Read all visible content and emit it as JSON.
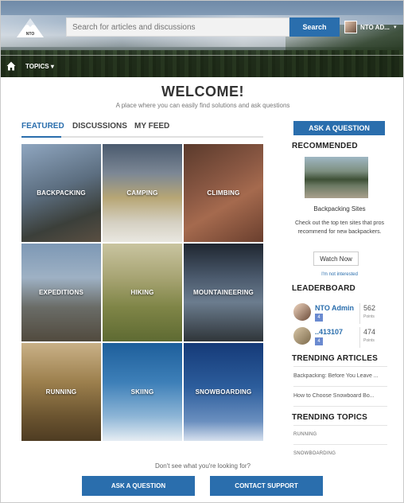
{
  "header": {
    "logo_text": "NTO",
    "search_placeholder": "Search for articles and discussions",
    "search_button": "Search",
    "user_name": "NTO AD...",
    "nav_topics": "TOPICS"
  },
  "main": {
    "welcome": "WELCOME!",
    "subtitle": "A place where you can easily find solutions and ask questions",
    "tabs": [
      "FEATURED",
      "DISCUSSIONS",
      "MY FEED"
    ],
    "active_tab": "FEATURED",
    "tiles": [
      {
        "label": "BACKPACKING",
        "color": "#5f6e7e"
      },
      {
        "label": "CAMPING",
        "color": "#8a8c80"
      },
      {
        "label": "CLIMBING",
        "color": "#7d4a36"
      },
      {
        "label": "EXPEDITIONS",
        "color": "#6a7d90"
      },
      {
        "label": "HIKING",
        "color": "#8d8a52"
      },
      {
        "label": "MOUNTAINEERING",
        "color": "#3e4a58"
      },
      {
        "label": "RUNNING",
        "color": "#7e6a3e"
      },
      {
        "label": "SKIING",
        "color": "#3d6fa0"
      },
      {
        "label": "SNOWBOARDING",
        "color": "#2c4f8c"
      }
    ]
  },
  "sidebar": {
    "ask_button": "ASK A QUESTION",
    "recommended_heading": "RECOMMENDED",
    "rec_title": "Backpacking Sites",
    "rec_desc": "Check out the top ten sites that pros recommend for new backpackers.",
    "watch_button": "Watch Now",
    "not_interested": "I'm not interested",
    "leaderboard_heading": "LEADERBOARD",
    "leaders": [
      {
        "name": "NTO Admin",
        "points": "562",
        "points_label": "Points",
        "badge": "4"
      },
      {
        "name": "..413107",
        "points": "474",
        "points_label": "Points",
        "badge": "4"
      }
    ],
    "trending_articles_heading": "TRENDING ARTICLES",
    "trending_articles": [
      "Backpacking: Before You Leave ...",
      "How to Choose Snowboard Bo..."
    ],
    "trending_topics_heading": "TRENDING TOPICS",
    "trending_topics": [
      "RUNNING",
      "SNOWBOARDING"
    ]
  },
  "footer": {
    "dont_see": "Don't see what you're looking for?",
    "ask_button": "ASK A QUESTION",
    "contact_button": "CONTACT SUPPORT"
  },
  "colors": {
    "accent": "#2a6ead"
  }
}
